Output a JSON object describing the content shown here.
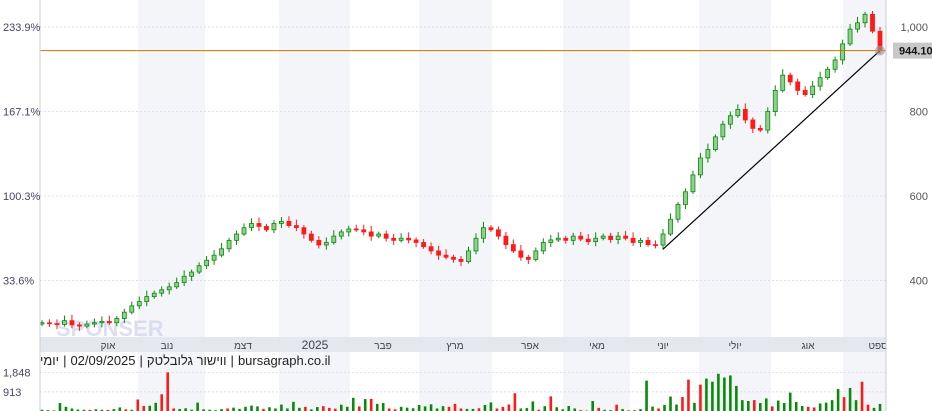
{
  "chart_data": {
    "type": "candlestick",
    "title": "",
    "price_axis": {
      "ticks": [
        1000,
        800,
        600,
        400
      ],
      "tick_labels": [
        "1,000",
        "800",
        "600",
        "400"
      ],
      "ylim": [
        210,
        1060
      ]
    },
    "percent_axis": {
      "tick_labels": [
        "233.9%",
        "167.1%",
        "100.3%",
        "33.6%"
      ]
    },
    "x_tick_labels": [
      "אוק",
      "נוב",
      "דצמ",
      "2025",
      "פבר",
      "מרץ",
      "אפר",
      "מאי",
      "יוני",
      "יולי",
      "אוג",
      "ספט"
    ],
    "last_price": 944.1,
    "last_price_label": "944.10",
    "closes": [
      300,
      298,
      296,
      305,
      295,
      292,
      297,
      300,
      303,
      300,
      310,
      325,
      340,
      350,
      362,
      370,
      378,
      385,
      395,
      410,
      420,
      435,
      448,
      460,
      475,
      495,
      510,
      525,
      535,
      528,
      520,
      535,
      540,
      530,
      525,
      510,
      495,
      484,
      490,
      505,
      515,
      522,
      520,
      515,
      505,
      510,
      500,
      495,
      500,
      496,
      490,
      480,
      470,
      460,
      455,
      450,
      445,
      470,
      500,
      525,
      520,
      505,
      485,
      470,
      455,
      450,
      470,
      490,
      496,
      500,
      495,
      505,
      498,
      492,
      500,
      505,
      497,
      505,
      500,
      490,
      495,
      485,
      484,
      510,
      545,
      580,
      610,
      650,
      690,
      710,
      740,
      770,
      790,
      805,
      780,
      760,
      756,
      800,
      850,
      886,
      870,
      850,
      840,
      860,
      880,
      900,
      922,
      960,
      995,
      1010,
      1030,
      990,
      944.1
    ],
    "volume_axis": {
      "tick_labels": [
        "1,848",
        "913"
      ],
      "ticks": [
        1848,
        913
      ],
      "ylim": [
        0,
        1960
      ]
    },
    "volumes": [
      60,
      40,
      30,
      380,
      200,
      120,
      70,
      60,
      50,
      80,
      60,
      50,
      90,
      170,
      80,
      60,
      550,
      240,
      250,
      390,
      800,
      1848,
      120,
      100,
      130,
      60,
      400,
      80,
      60,
      40,
      90,
      120,
      160,
      100,
      200,
      260,
      220,
      100,
      180,
      120,
      310,
      120,
      440,
      150,
      200,
      80,
      190,
      230,
      150,
      110,
      300,
      200,
      630,
      220,
      570,
      580,
      340,
      380,
      120,
      80,
      200,
      160,
      130,
      290,
      220,
      320,
      120,
      230,
      200,
      340,
      120,
      100,
      100,
      130,
      290,
      410,
      120,
      200,
      310,
      850,
      120,
      140,
      460,
      60,
      230,
      700,
      180,
      80,
      240,
      120,
      40,
      20,
      480,
      150,
      60,
      40,
      300,
      90,
      30,
      40,
      90,
      1450,
      210,
      120,
      290,
      690,
      310,
      670,
      1500,
      390,
      1260,
      1550,
      1400,
      1780,
      1600,
      1700,
      1200,
      520,
      480,
      520,
      380,
      600,
      220,
      500,
      380,
      880,
      430,
      240,
      200,
      170,
      360,
      400,
      520,
      1050,
      660,
      1100,
      520,
      1400,
      300,
      150,
      340
    ],
    "trendline": {
      "from_price": 474,
      "to_price": 944.1
    },
    "colors": {
      "up": "#0a8a0a",
      "down": "#ff1a1a",
      "last_price_line": "#d07000",
      "trendline": "#000000",
      "axis_bar": "#e4e7ed",
      "band": "#f4f5f8"
    }
  },
  "caption": {
    "parts": [
      "יומי",
      "|",
      "02/09/2025",
      "|",
      "ווישור גלובלטק",
      "|",
      "bursagraph.co.il"
    ]
  },
  "watermark": "SPONSER"
}
